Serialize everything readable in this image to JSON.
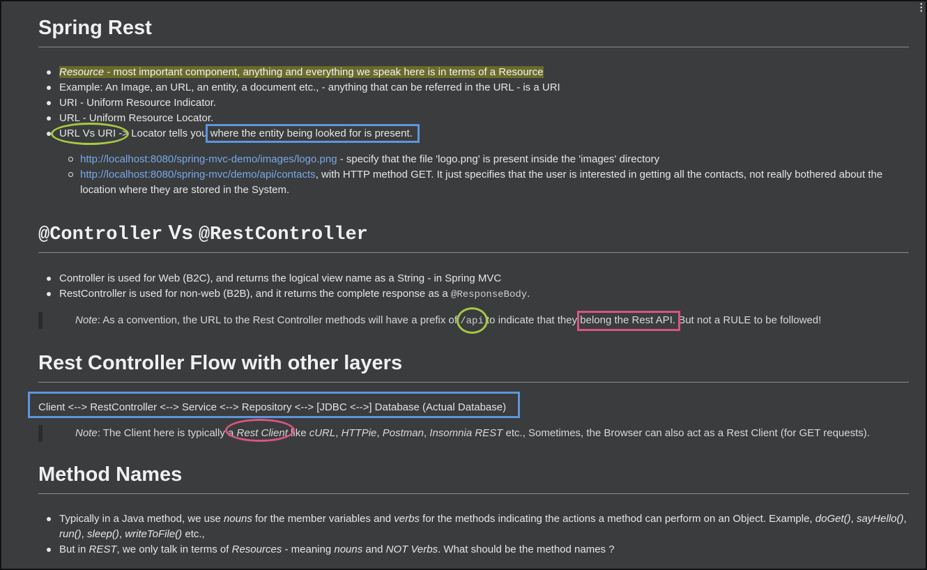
{
  "section1": {
    "title": "Spring Rest",
    "bullets": {
      "b1_em": "Resource",
      "b1_rest": " - most important component, anything and everything we speak here is in terms of a Resource",
      "b2": "Example: An Image, an URL, an entity, a document etc., - anything that can be referred in the URL - is a URI",
      "b3": "URI - Uniform Resource Indicator.",
      "b4": "URL - Uniform Resource Locator.",
      "b5_a": "URL Vs URI -> Locator tells you ",
      "b5_b": "where the entity being looked for is present."
    },
    "sub": {
      "s1_link": "http://localhost:8080/spring-mvc-demo/images/logo.png",
      "s1_text": " - specify that the file 'logo.png' is present inside the 'images' directory",
      "s2_link": "http://localhost:8080/spring-mvc/demo/api/contacts",
      "s2_text1": ", with HTTP method GET. It just specifies that the user is interested in getting all the contacts, not really bothered about the",
      "s2_text2": "location where they are stored in the System."
    }
  },
  "section2": {
    "title_a": "@Controller",
    "title_vs": " Vs ",
    "title_b": "@RestController",
    "b1": "Controller is used for Web (B2C), and returns the logical view name as a String - in Spring MVC",
    "b2_a": "RestController is used for non-web (B2B), and it returns the complete response as a ",
    "b2_code": "@ResponseBody",
    "b2_end": ".",
    "note_label": "Note",
    "note_a": ": As a convention, the URL to the Rest Controller methods will have a prefix of ",
    "note_code": "/api",
    "note_b": " to indicate that they ",
    "note_c": "belong the Rest API",
    "note_d": ". But not a RULE to be followed!"
  },
  "section3": {
    "title": "Rest Controller Flow with other layers",
    "flow": "Client <--> RestController <--> Service <--> Repository <--> [JDBC <-->] Database (Actual Database)",
    "note_label": "Note",
    "note_a": ": The Client here is typically a ",
    "note_em1": "Rest Client",
    "note_b": " like ",
    "note_em2": "cURL",
    "note_c": ", ",
    "note_em3": "HTTPie",
    "note_d": ", ",
    "note_em4": "Postman",
    "note_e": ", ",
    "note_em5": "Insomnia REST",
    "note_f": " etc., Sometimes, the Browser can also act as a Rest Client (for GET requests)."
  },
  "section4": {
    "title": "Method Names",
    "b1_a": "Typically in a Java method, we use ",
    "b1_em1": "nouns",
    "b1_b": " for the member variables and ",
    "b1_em2": "verbs",
    "b1_c": " for the methods indicating the actions a method can perform on an Object. Example, ",
    "b1_em3": "doGet()",
    "b1_d": ", ",
    "b1_em4": "sayHello()",
    "b1_e": ",",
    "b1_em5": "run()",
    "b1_f": ", ",
    "b1_em6": "sleep()",
    "b1_g": ", ",
    "b1_em7": "writeToFile()",
    "b1_h": " etc.,",
    "b2_a": "But in ",
    "b2_em1": "REST",
    "b2_b": ", we only talk in terms of ",
    "b2_em2": "Resources",
    "b2_c": " - meaning ",
    "b2_em3": "nouns",
    "b2_d": " and ",
    "b2_em4": "NOT Verbs",
    "b2_e": ". What should be the method names ?"
  }
}
